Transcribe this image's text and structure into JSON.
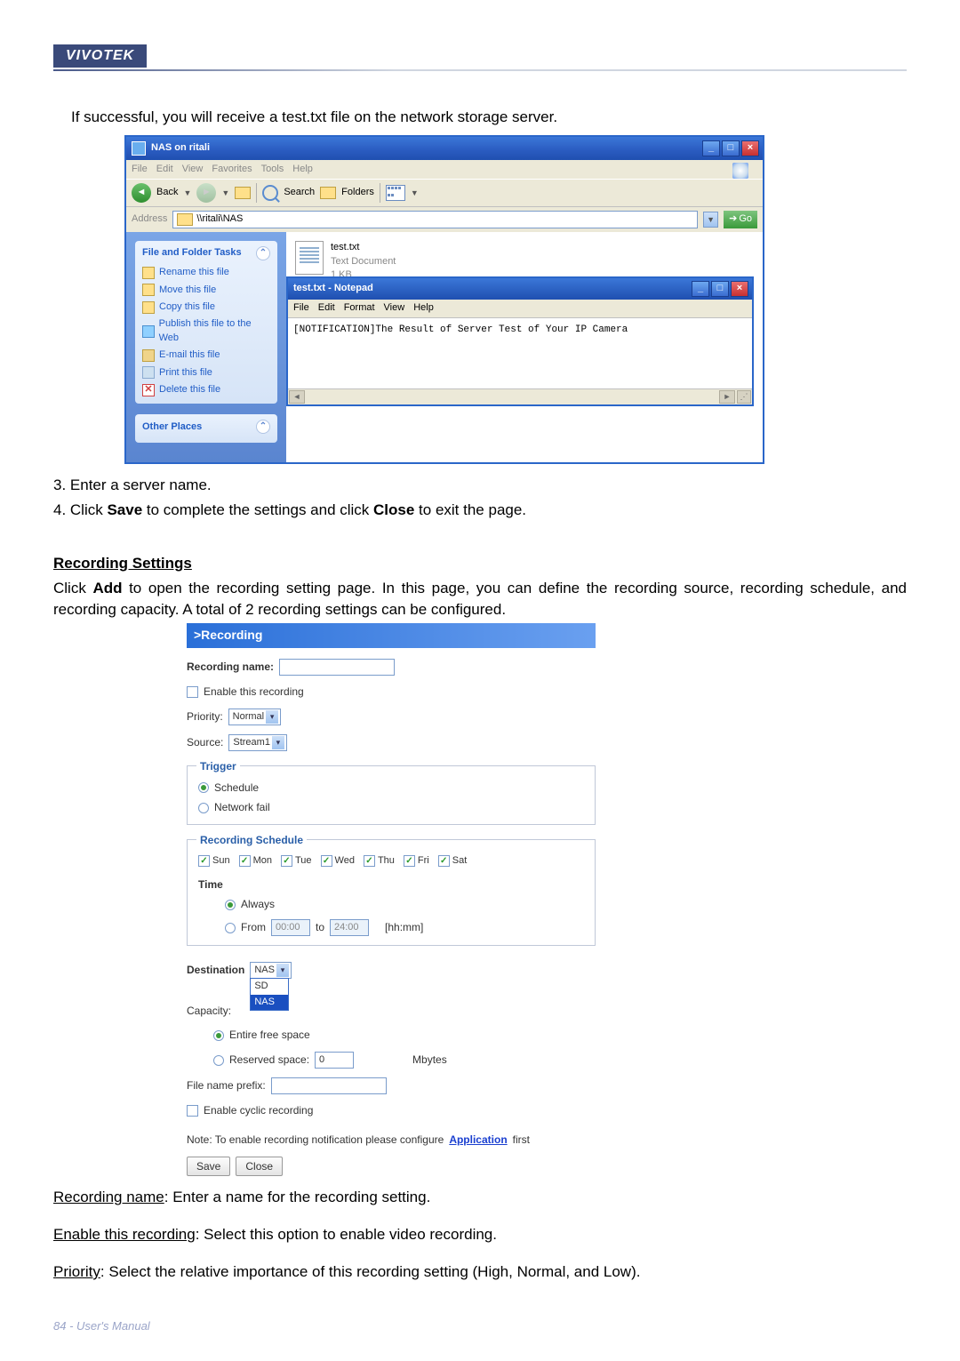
{
  "brand": "VIVOTEK",
  "intro": "If successful, you will receive a test.txt file on the network storage server.",
  "explorer": {
    "title": "NAS on ritali",
    "menu": [
      "File",
      "Edit",
      "View",
      "Favorites",
      "Tools",
      "Help"
    ],
    "toolbar": {
      "back": "Back",
      "search": "Search",
      "folders": "Folders"
    },
    "address_label": "Address",
    "address_value": "\\\\ritali\\NAS",
    "go": "Go",
    "tasks_header": "File and Folder Tasks",
    "tasks": [
      "Rename this file",
      "Move this file",
      "Copy this file",
      "Publish this file to the Web",
      "E-mail this file",
      "Print this file",
      "Delete this file"
    ],
    "other_places": "Other Places",
    "file": {
      "name": "test.txt",
      "type": "Text Document",
      "size": "1 KB"
    },
    "notepad": {
      "title": "test.txt - Notepad",
      "menu": [
        "File",
        "Edit",
        "Format",
        "View",
        "Help"
      ],
      "body": "[NOTIFICATION]The Result of Server Test of Your IP Camera"
    }
  },
  "steps": {
    "s3": "3. Enter a server name.",
    "s4_a": "4. Click ",
    "s4_b": "Save",
    "s4_c": " to complete the settings and click ",
    "s4_d": "Close",
    "s4_e": " to exit the page."
  },
  "rec_heading": "Recording Settings",
  "rec_intro_a": "Click ",
  "rec_intro_b": "Add",
  "rec_intro_c": " to open the recording setting page. In this page, you can define the recording source, recording schedule, and recording capacity. A total of 2 recording settings can be configured.",
  "form": {
    "header": ">Recording",
    "name_label": "Recording name:",
    "enable": "Enable this recording",
    "priority_label": "Priority:",
    "priority_value": "Normal",
    "source_label": "Source:",
    "source_value": "Stream1",
    "trigger_legend": "Trigger",
    "trigger_schedule": "Schedule",
    "trigger_network": "Network fail",
    "schedule_legend": "Recording Schedule",
    "days": [
      "Sun",
      "Mon",
      "Tue",
      "Wed",
      "Thu",
      "Fri",
      "Sat"
    ],
    "time_label": "Time",
    "always": "Always",
    "from": "From",
    "from_val": "00:00",
    "to": "to",
    "to_val": "24:00",
    "hhmm": "[hh:mm]",
    "dest_label": "Destination",
    "dest_value": "NAS",
    "dest_opts": [
      "SD",
      "NAS"
    ],
    "capacity_label": "Capacity:",
    "entire": "Entire free space",
    "reserved": "Reserved space:",
    "reserved_val": "0",
    "mbytes": "Mbytes",
    "prefix_label": "File name prefix:",
    "cyclic": "Enable cyclic recording",
    "note_a": "Note: To enable recording notification please configure ",
    "note_link": "Application",
    "note_b": " first",
    "save": "Save",
    "close": "Close"
  },
  "desc": {
    "rec_name_u": "Recording name",
    "rec_name_t": ": Enter a name for the recording setting.",
    "enable_u": "Enable this recording",
    "enable_t": ": Select this option to enable video recording.",
    "priority_u": "Priority",
    "priority_t": ": Select the relative importance of this recording setting (High, Normal, and Low)."
  },
  "footer": "84 - User's Manual"
}
